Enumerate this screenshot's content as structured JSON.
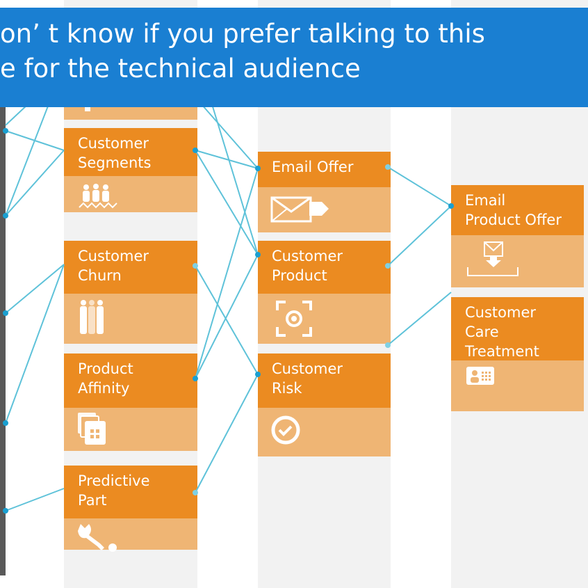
{
  "banner": {
    "line1": "on’ t know if you prefer talking to this",
    "line2": "e for the technical audience"
  },
  "colors": {
    "banner": "#1a7fd2",
    "card_head": "#eb8b21",
    "card_body": "#efb574",
    "connector": "#5ec2d9",
    "lane": "#f2f2f2"
  },
  "cards": [
    {
      "id": "customer-segments",
      "label": "Customer\nSegments",
      "icon": "people-group-icon"
    },
    {
      "id": "customer-churn",
      "label": "Customer\nChurn",
      "icon": "people-fading-icon"
    },
    {
      "id": "product-affinity",
      "label": "Product\nAffinity",
      "icon": "stacked-products-icon"
    },
    {
      "id": "predictive-part",
      "label": "Predictive\nPart",
      "icon": "wrench-icon"
    },
    {
      "id": "email-offer",
      "label": "Email Offer",
      "icon": "envelope-send-icon"
    },
    {
      "id": "customer-product",
      "label": "Customer\nProduct",
      "icon": "focus-target-icon"
    },
    {
      "id": "customer-risk",
      "label": "Customer\nRisk",
      "icon": "check-circle-icon"
    },
    {
      "id": "email-product-offer",
      "label": "Email\nProduct Offer",
      "icon": "envelope-download-icon"
    },
    {
      "id": "customer-care-treatment",
      "label": "Customer\nCare\nTreatment",
      "icon": "contact-card-icon"
    }
  ]
}
